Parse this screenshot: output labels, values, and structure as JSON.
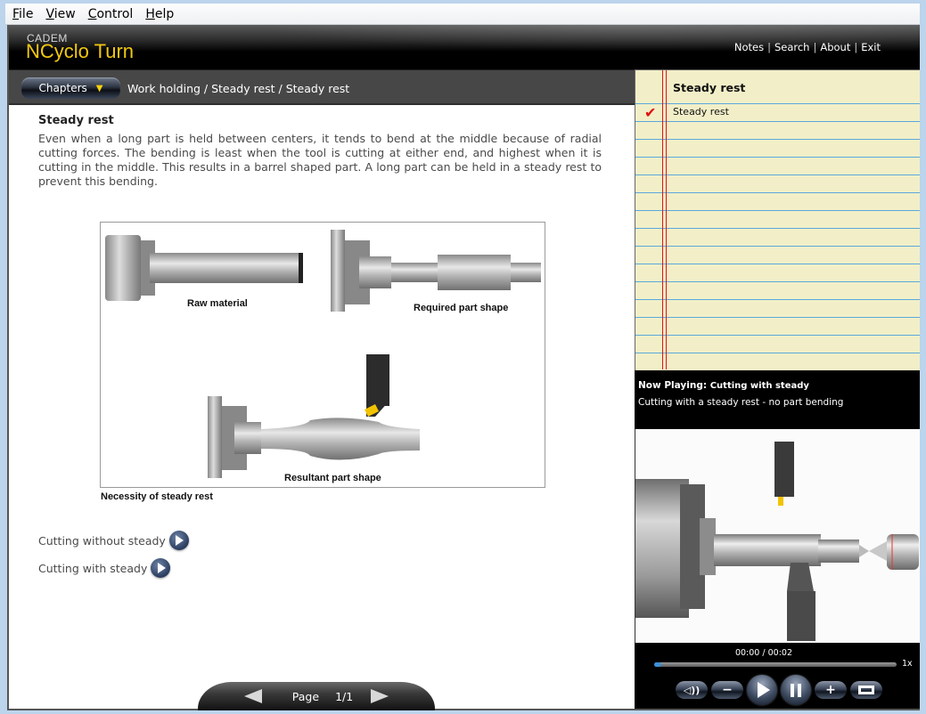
{
  "menubar": {
    "items": [
      {
        "accel": "F",
        "rest": "ile"
      },
      {
        "accel": "V",
        "rest": "iew"
      },
      {
        "accel": "C",
        "rest": "ontrol"
      },
      {
        "accel": "H",
        "rest": "elp"
      }
    ]
  },
  "header": {
    "brand_small": "CADEM",
    "brand_big": "NCyclo Turn",
    "links": [
      "Notes",
      "Search",
      "About",
      "Exit"
    ],
    "separator": "|"
  },
  "toolbar": {
    "chapters_label": "Chapters",
    "chapters_arrow": "▼",
    "breadcrumb": "Work holding / Steady rest / Steady rest"
  },
  "topic": {
    "title": "Steady rest",
    "text": "Even when a long part is held between centers, it tends to bend at the middle because of radial cutting forces. The bending is least when the tool is cutting at either end, and highest when it is cutting in the middle. This results in a barrel shaped part. A long part can be held in a steady rest to prevent this bending.",
    "figure": {
      "labels": [
        "Raw material",
        "Required part shape",
        "Resultant part shape"
      ],
      "caption": "Necessity of steady rest"
    },
    "video_links": [
      "Cutting without steady",
      "Cutting with steady"
    ]
  },
  "pager": {
    "label": "Page",
    "value": "1/1"
  },
  "notes": {
    "title": "Steady rest",
    "items": [
      {
        "label": "Steady rest",
        "checked": true,
        "check_glyph": "✔"
      }
    ]
  },
  "now_playing": {
    "label": "Now Playing:",
    "title": "Cutting with steady",
    "description": "Cutting with a steady rest - no part bending"
  },
  "player": {
    "current_time": "00:00",
    "separator": "/",
    "duration": "00:02",
    "speed": "1x",
    "progress_fraction": 0.03,
    "buttons": [
      "mute",
      "volume-down",
      "play",
      "pause",
      "volume-up",
      "fullscreen"
    ]
  },
  "colors": {
    "brand_yellow": "#f2c811",
    "notes_paper": "#f2efc8",
    "notes_rule": "#5aa8dc",
    "margin_red": "#e31313",
    "seek_fill": "#3a8fd8"
  }
}
